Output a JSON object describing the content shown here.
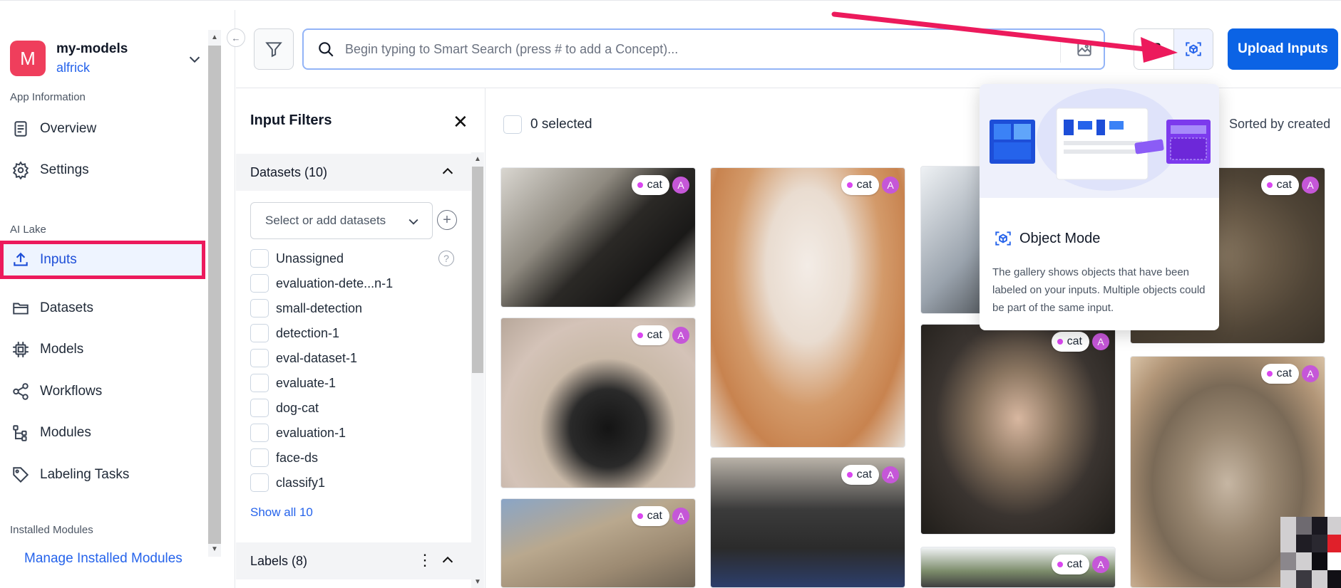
{
  "app": {
    "avatar_letter": "M",
    "name": "my-models",
    "user": "alfrick"
  },
  "sidebar": {
    "section_app_info": "App Information",
    "section_ai_lake": "AI Lake",
    "section_installed": "Installed Modules",
    "items": [
      {
        "label": "Overview",
        "icon": "document-icon"
      },
      {
        "label": "Settings",
        "icon": "gear-icon"
      },
      {
        "label": "Inputs",
        "icon": "upload-icon",
        "active": true
      },
      {
        "label": "Datasets",
        "icon": "folder-icon"
      },
      {
        "label": "Models",
        "icon": "chip-icon"
      },
      {
        "label": "Workflows",
        "icon": "share-icon"
      },
      {
        "label": "Modules",
        "icon": "tree-icon"
      },
      {
        "label": "Labeling Tasks",
        "icon": "tag-icon"
      }
    ],
    "manage_modules": "Manage Installed Modules"
  },
  "search": {
    "placeholder": "Begin typing to Smart Search (press # to add a Concept)..."
  },
  "toolbar": {
    "upload_label": "Upload Inputs"
  },
  "filters": {
    "title": "Input Filters",
    "datasets_header": "Datasets (10)",
    "select_placeholder": "Select or add datasets",
    "datasets": [
      "Unassigned",
      "evaluation-dete...n-1",
      "small-detection",
      "detection-1",
      "eval-dataset-1",
      "evaluate-1",
      "dog-cat",
      "evaluation-1",
      "face-ds",
      "classify1"
    ],
    "show_all": "Show all 10",
    "labels_header": "Labels (8)"
  },
  "gallery": {
    "selected_text": "0 selected",
    "sorted_text": "Sorted by created",
    "tag_label": "cat",
    "tag_badge": "A"
  },
  "popover": {
    "title": "Object Mode",
    "body": "The gallery shows objects that have been labeled on your inputs. Multiple objects could be part of the same input."
  },
  "colors": {
    "accent": "#0b63e5",
    "highlight": "#ec1a5c",
    "avatar": "#ef3e5c",
    "tag_dot": "#d946ef"
  }
}
